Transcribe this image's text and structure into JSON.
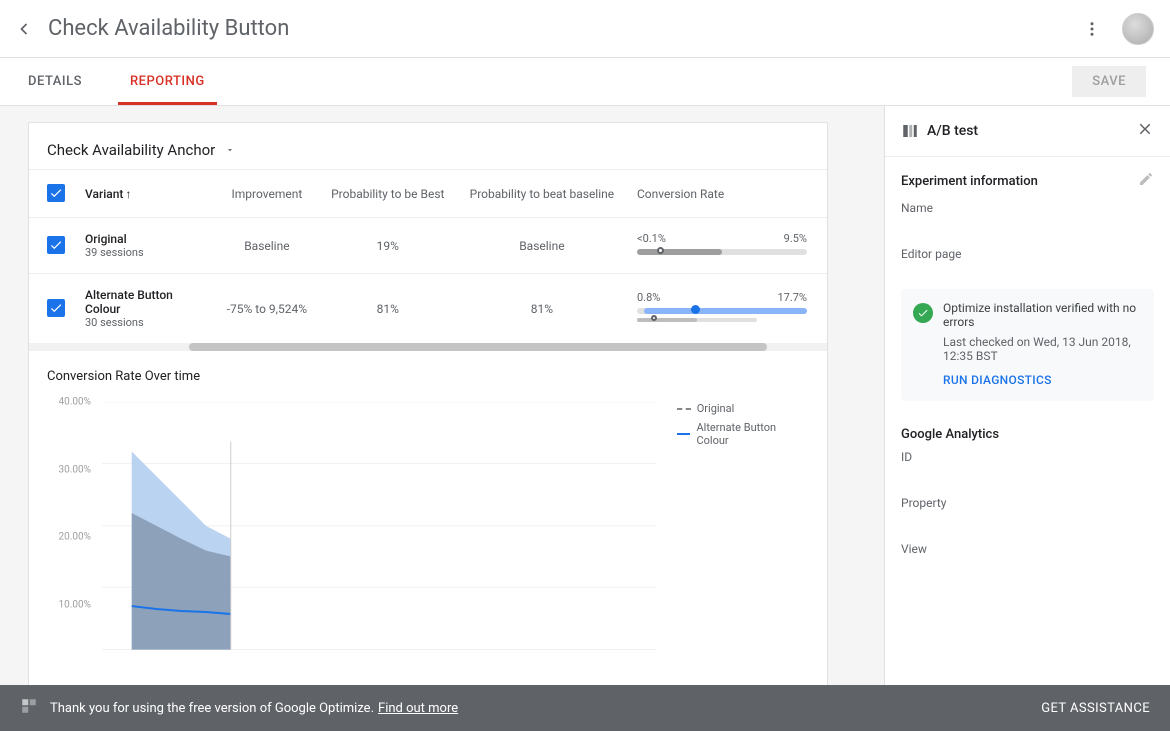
{
  "header": {
    "title": "Check Availability Button",
    "save_label": "SAVE"
  },
  "tabs": {
    "details": "DETAILS",
    "reporting": "REPORTING",
    "active": "reporting"
  },
  "objective": {
    "label": "Check Availability Anchor"
  },
  "table": {
    "columns": {
      "variant": "Variant",
      "improvement": "Improvement",
      "prob_best": "Probability to be Best",
      "prob_beat": "Probability to beat baseline",
      "conv_rate": "Conversion Rate"
    },
    "rows": [
      {
        "name": "Original",
        "sessions": "39 sessions",
        "improvement": "Baseline",
        "prob_best": "19%",
        "prob_beat": "Baseline",
        "cr_low": "<0.1%",
        "cr_high": "9.5%"
      },
      {
        "name": "Alternate Button Colour",
        "sessions": "30 sessions",
        "improvement": "-75% to 9,524%",
        "prob_best": "81%",
        "prob_beat": "81%",
        "cr_low": "0.8%",
        "cr_high": "17.7%"
      }
    ]
  },
  "chart_title": "Conversion Rate Over time",
  "chart_legend": {
    "series1": "Original",
    "series2": "Alternate Button Colour"
  },
  "chart_data": {
    "type": "line",
    "ylabel": "Conversion Rate",
    "ylim": [
      0,
      40
    ],
    "yticks": [
      "40.00%",
      "30.00%",
      "20.00%",
      "10.00%"
    ],
    "x": [
      0,
      1,
      2,
      3,
      4
    ],
    "series": [
      {
        "name": "Original",
        "style": "dashed-gray",
        "values_band_upper": [
          22,
          20,
          18,
          16,
          15
        ],
        "values_band_lower": [
          0,
          0,
          0,
          0,
          0
        ]
      },
      {
        "name": "Alternate Button Colour",
        "style": "solid-blue",
        "values_band_upper": [
          32,
          28,
          24,
          20,
          18
        ],
        "values_band_lower": [
          0,
          0,
          0,
          0,
          0
        ],
        "values_line": [
          7,
          6.5,
          6.2,
          6,
          5.8
        ]
      }
    ]
  },
  "sidebar": {
    "panel_title": "A/B test",
    "exp_info_title": "Experiment information",
    "name_label": "Name",
    "editor_label": "Editor page",
    "status_msg": "Optimize installation verified with no errors",
    "status_ts": "Last checked on Wed, 13 Jun 2018, 12:35 BST",
    "diag_link": "RUN DIAGNOSTICS",
    "ga_title": "Google Analytics",
    "ga_id": "ID",
    "ga_property": "Property",
    "ga_view": "View"
  },
  "footer": {
    "msg": "Thank you for using the free version of Google Optimize.",
    "link": "Find out more",
    "assist": "GET ASSISTANCE"
  }
}
